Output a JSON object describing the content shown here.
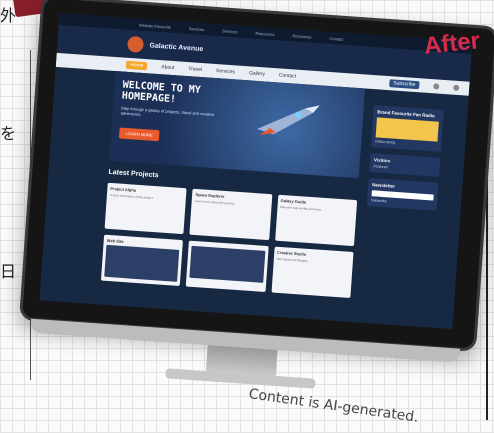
{
  "annotation": {
    "after_label": "After",
    "caption": "Content is AI-generated.",
    "left_text": [
      "外",
      "を",
      "日"
    ]
  },
  "website": {
    "topbar_items": [
      "Website Favourite",
      "Services",
      "Services",
      "Resources",
      "Resources",
      "Contact"
    ],
    "brand_name": "Galactic Avenue",
    "nav_items": [
      "Home",
      "About",
      "Travel",
      "Services",
      "Gallery",
      "Contact"
    ],
    "nav_button": "Subscribe",
    "hero_title": "WELCOME TO MY HOMEPAGE!",
    "hero_subtitle": "Step through a galaxy of projects, travel and creative adventures.",
    "hero_button": "LEARN MORE",
    "section_title": "Latest Projects",
    "cards": [
      {
        "title": "Project Alpha",
        "text": "A short description of the project."
      },
      {
        "title": "Space Explorer",
        "text": "Learn more about the journey."
      },
      {
        "title": "Galaxy Guide",
        "text": "Discover new worlds and more."
      },
      {
        "title": "Web Site",
        "text": ""
      },
      {
        "title": "",
        "text": ""
      },
      {
        "title": "Creative Studio",
        "text": "New ideas and designs."
      }
    ],
    "sidebar": {
      "box1_title": "Brand Favourite Fan Radio",
      "box1_text": "Follow along",
      "box2_title": "Visitors",
      "box2_text": "Featured",
      "box3_title": "Newsletter",
      "box3_text": "Subscribe"
    }
  },
  "colors": {
    "after_label": "#d82a49",
    "accent": "#f5a623",
    "hero_button": "#ea5b2b",
    "screen_bg": "#172843"
  }
}
